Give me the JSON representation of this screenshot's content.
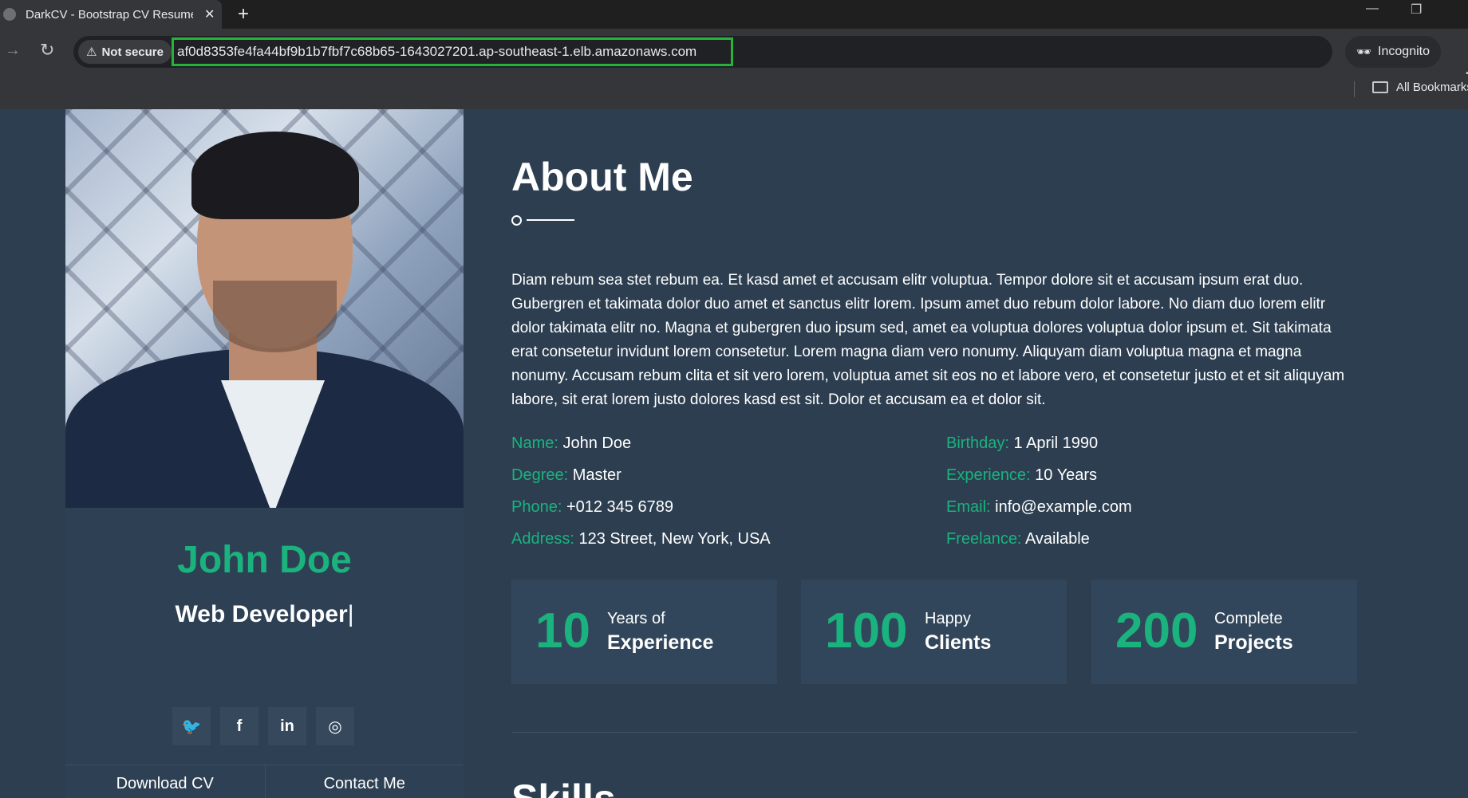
{
  "browser": {
    "tab_title": "DarkCV - Bootstrap CV Resume",
    "tab_close": "✕",
    "new_tab": "+",
    "security_label": "Not secure",
    "url": "af0d8353fe4fa44bf9b1b7fbf7c68b65-1643027201.ap-southeast-1.elb.amazonaws.com",
    "incognito_label": "Incognito",
    "bookmarks_label": "All Bookmarks",
    "icons": [
      "forward-icon",
      "reload-icon",
      "warning-icon",
      "star-icon",
      "incognito-icon",
      "menu-icon",
      "folder-icon"
    ]
  },
  "sidebar": {
    "name": "John Doe",
    "role": "Web Developer",
    "cursor": "|",
    "social": [
      {
        "icon": "twitter-icon",
        "glyph": "🐦"
      },
      {
        "icon": "facebook-icon",
        "glyph": "f"
      },
      {
        "icon": "linkedin-icon",
        "glyph": "in"
      },
      {
        "icon": "instagram-icon",
        "glyph": "◎"
      }
    ],
    "download_cv": "Download CV",
    "contact_me": "Contact Me"
  },
  "about": {
    "title": "About Me",
    "bio": "Diam rebum sea stet rebum ea. Et kasd amet et accusam elitr voluptua. Tempor dolore sit et accusam ipsum erat duo. Gubergren et takimata dolor duo amet et sanctus elitr lorem. Ipsum amet duo rebum dolor labore. No diam duo lorem elitr dolor takimata elitr no. Magna et gubergren duo ipsum sed, amet ea voluptua dolores voluptua dolor ipsum et. Sit takimata erat consetetur invidunt lorem consetetur. Lorem magna diam vero nonumy. Aliquyam diam voluptua magna et magna nonumy. Accusam rebum clita et sit vero lorem, voluptua amet sit eos no et labore vero, et consetetur justo et et sit aliquyam labore, sit erat lorem justo dolores kasd est sit. Dolor et accusam ea et dolor sit.",
    "info": {
      "name": {
        "label": "Name:",
        "value": "John Doe"
      },
      "degree": {
        "label": "Degree:",
        "value": "Master"
      },
      "phone": {
        "label": "Phone:",
        "value": "+012 345 6789"
      },
      "address": {
        "label": "Address:",
        "value": "123 Street, New York, USA"
      },
      "birthday": {
        "label": "Birthday:",
        "value": "1 April 1990"
      },
      "experience": {
        "label": "Experience:",
        "value": "10 Years"
      },
      "email": {
        "label": "Email:",
        "value": "info@example.com"
      },
      "freelance": {
        "label": "Freelance:",
        "value": "Available"
      }
    },
    "stats": [
      {
        "number": "10",
        "line1": "Years of",
        "line2": "Experience"
      },
      {
        "number": "100",
        "line1": "Happy",
        "line2": "Clients"
      },
      {
        "number": "200",
        "line1": "Complete",
        "line2": "Projects"
      }
    ]
  },
  "skills": {
    "title": "Skills"
  },
  "colors": {
    "accent": "#1ab37e",
    "background": "#2c3e50",
    "card": "#32465b"
  }
}
